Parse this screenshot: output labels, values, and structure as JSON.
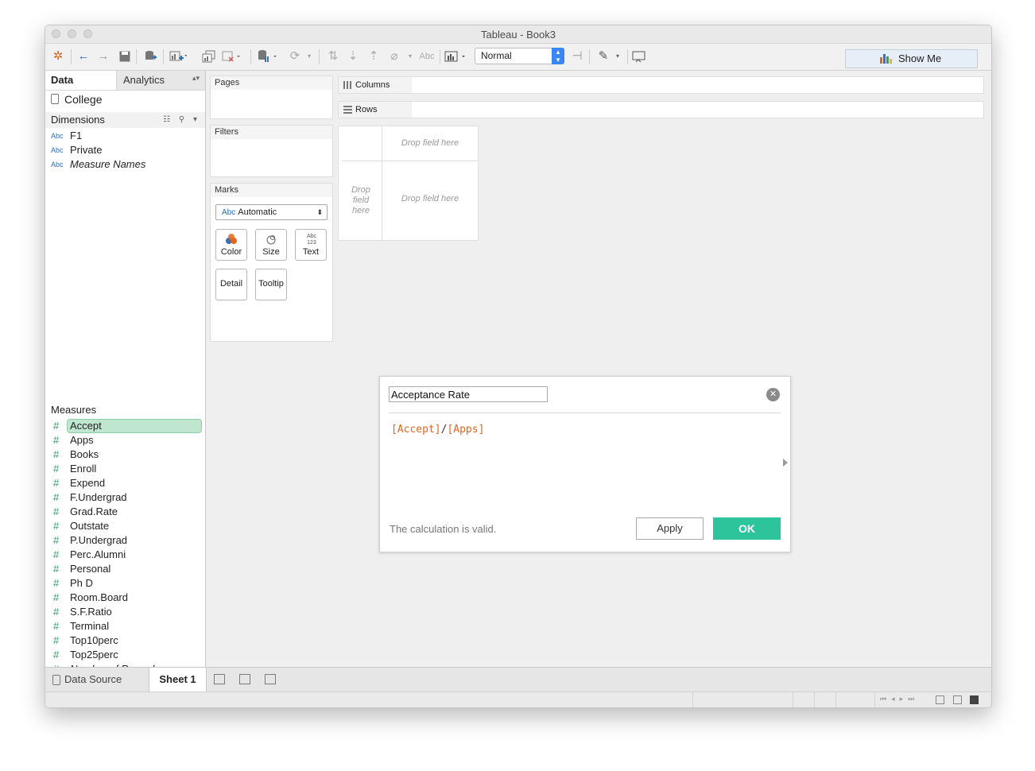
{
  "window": {
    "title": "Tableau - Book3"
  },
  "toolbar": {
    "view_mode": "Normal",
    "abc_label": "Abc",
    "show_me_label": "Show Me"
  },
  "data_pane": {
    "tabs": [
      "Data",
      "Analytics"
    ],
    "datasource": "College",
    "dimensions_header": "Dimensions",
    "dimensions": [
      {
        "type": "Abc",
        "name": "F1"
      },
      {
        "type": "Abc",
        "name": "Private"
      },
      {
        "type": "Abc",
        "name": "Measure Names"
      }
    ],
    "measures_header": "Measures",
    "measures": [
      "Accept",
      "Apps",
      "Books",
      "Enroll",
      "Expend",
      "F.Undergrad",
      "Grad.Rate",
      "Outstate",
      "P.Undergrad",
      "Perc.Alumni",
      "Personal",
      "Ph D",
      "Room.Board",
      "S.F.Ratio",
      "Terminal",
      "Top10perc",
      "Top25perc",
      "Number of Records"
    ],
    "selected_measure": "Accept"
  },
  "cards": {
    "pages": "Pages",
    "filters": "Filters",
    "marks": "Marks",
    "mark_type_prefix": "Abc",
    "mark_type": "Automatic",
    "mark_buttons": [
      "Color",
      "Size",
      "Text",
      "Detail",
      "Tooltip"
    ],
    "text_icon": "Abc 123"
  },
  "shelves": {
    "columns": "Columns",
    "rows": "Rows"
  },
  "view": {
    "drop_top": "Drop field here",
    "drop_left": "Drop field here",
    "drop_center": "Drop field here"
  },
  "calc_dialog": {
    "name": "Acceptance Rate",
    "formula_field1": "[Accept]",
    "formula_op": "/",
    "formula_field2": "[Apps]",
    "status": "The calculation is valid.",
    "apply_label": "Apply",
    "ok_label": "OK"
  },
  "bottom": {
    "datasource_tab": "Data Source",
    "sheet_tab": "Sheet 1"
  },
  "colors": {
    "accent_green": "#2ec49b",
    "field_orange": "#e0661d",
    "measure_green": "#2aa26a",
    "dimension_blue": "#2a6ebd"
  }
}
